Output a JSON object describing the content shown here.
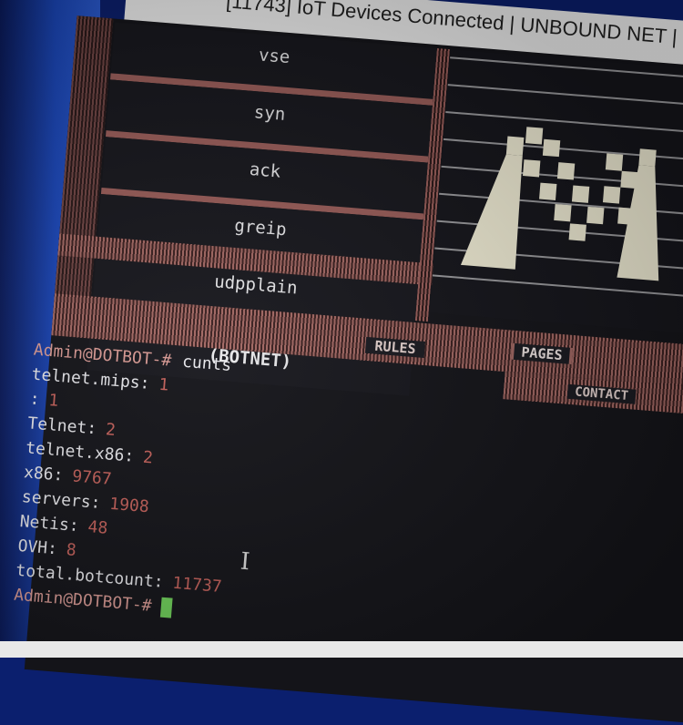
{
  "window": {
    "title": "[11743] IoT Devices Connected | UNBOUND NET | "
  },
  "menu": {
    "items": [
      {
        "label": "vse"
      },
      {
        "label": "syn"
      },
      {
        "label": "ack"
      },
      {
        "label": "greip"
      },
      {
        "label": "udpplain"
      },
      {
        "label": "(BOTNET)"
      }
    ]
  },
  "nav": {
    "rules": "RULES",
    "pages": "PAGES",
    "contact": "CONTACT"
  },
  "terminal": {
    "prompt": "Admin@DOTBOT-#",
    "command": "cunts",
    "rows": [
      {
        "key": "telnet.mips:",
        "value": "1"
      },
      {
        "key": ":",
        "value": "1"
      },
      {
        "key": "Telnet:",
        "value": "2"
      },
      {
        "key": "telnet.x86:",
        "value": "2"
      },
      {
        "key": "x86:",
        "value": "9767"
      },
      {
        "key": "servers:",
        "value": "1908"
      },
      {
        "key": "Netis:",
        "value": "48"
      },
      {
        "key": "OVH:",
        "value": "8"
      },
      {
        "key": "total.botcount:",
        "value": "11737"
      }
    ],
    "final_prompt": "Admin@DOTBOT-#"
  },
  "colors": {
    "accent": "#9b5e5a",
    "value": "#c2605a",
    "cursor": "#6fd05a",
    "background": "#141419"
  },
  "icons": {
    "art": "ascii-art-icon",
    "cursor": "text-cursor-icon"
  }
}
